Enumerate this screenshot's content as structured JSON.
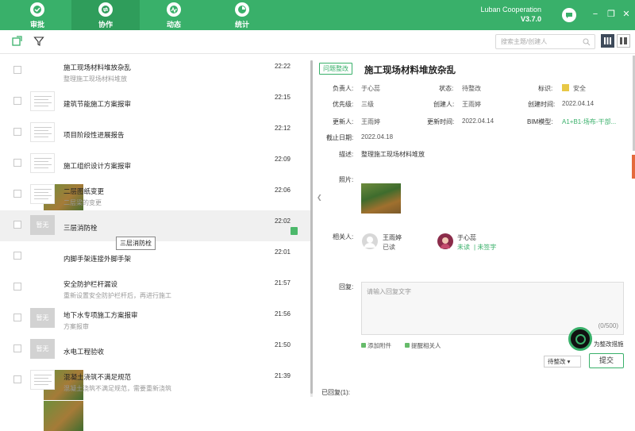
{
  "nav": {
    "tabs": [
      {
        "label": "审批",
        "icon": "approval-icon"
      },
      {
        "label": "协作",
        "icon": "collaboration-icon",
        "active": true
      },
      {
        "label": "动态",
        "icon": "activity-icon"
      },
      {
        "label": "统计",
        "icon": "statistics-icon"
      }
    ],
    "brand": "Luban Cooperation",
    "version": "V3.7.0"
  },
  "toolbar": {
    "search_placeholder": "搜索主题/创建人"
  },
  "list": {
    "items": [
      {
        "title": "施工现场材料堆放杂乱",
        "subtitle": "整理施工现场材料堆放",
        "time": "22:22",
        "thumb": "photo"
      },
      {
        "title": "建筑节能施工方案报审",
        "subtitle": "",
        "time": "22:15",
        "thumb": "doc"
      },
      {
        "title": "项目阶段性进展报告",
        "subtitle": "",
        "time": "22:12",
        "thumb": "doc"
      },
      {
        "title": "施工组织设计方案报审",
        "subtitle": "",
        "time": "22:09",
        "thumb": "doc"
      },
      {
        "title": "二层图纸变更",
        "subtitle": "二层梁的变更",
        "time": "22:06",
        "thumb": "doc"
      },
      {
        "title": "三层消防栓",
        "subtitle": "",
        "time": "22:02",
        "thumb": "none",
        "thumb_text": "暂无"
      },
      {
        "title": "内脚手架连接外脚手架",
        "subtitle": "",
        "time": "22:01",
        "thumb": "photo"
      },
      {
        "title": "安全防护栏杆漏设",
        "subtitle": "重新设置安全防护栏杆后，再进行施工",
        "time": "21:57",
        "thumb": "photo"
      },
      {
        "title": "地下水专项施工方案报审",
        "subtitle": "方案报审",
        "time": "21:56",
        "thumb": "none",
        "thumb_text": "暂无"
      },
      {
        "title": "水电工程验收",
        "subtitle": "",
        "time": "21:50",
        "thumb": "none",
        "thumb_text": "暂无"
      },
      {
        "title": "混凝土浇筑不满足规范",
        "subtitle": "混凝土浇筑不满足规范，需要重新浇筑",
        "time": "21:39",
        "thumb": "doc"
      }
    ],
    "tooltip": "三层消防栓"
  },
  "detail": {
    "tag": "问题整改",
    "title": "施工现场材料堆放杂乱",
    "fields": {
      "owner_label": "负责人:",
      "owner": "于心蕊",
      "status_label": "状态:",
      "status": "待整改",
      "mark_label": "标识:",
      "mark": "安全",
      "priority_label": "优先级:",
      "priority": "三级",
      "creator_label": "创建人:",
      "creator": "王雨婷",
      "created_label": "创建时间:",
      "created": "2022.04.14",
      "updater_label": "更新人:",
      "updater": "王雨婷",
      "updated_label": "更新时间:",
      "updated": "2022.04.14",
      "bim_label": "BIM模型:",
      "bim": "A1+B1-场布-干部...",
      "deadline_label": "截止日期:",
      "deadline": "2022.04.18",
      "desc_label": "描述:",
      "desc": "整理施工现场材料堆放",
      "photo_label": "照片:",
      "related_label": "相关人:",
      "reply_label": "回复:"
    },
    "related": [
      {
        "name": "王雨婷",
        "state": "已读"
      },
      {
        "name": "于心蕊",
        "state": "未读",
        "sign": "未签字"
      }
    ],
    "reply_placeholder": "请输入回复文字",
    "reply_count": "(0/500)",
    "attach": "添加附件",
    "remind": "提醒相关人",
    "partial_text": "为整改措施",
    "status_select": "待整改",
    "submit": "提交",
    "replies_label": "已回复(1):"
  },
  "colors": {
    "accent": "#39b06a",
    "nav_active": "#2f9d5b",
    "mark": "#e8c846"
  }
}
